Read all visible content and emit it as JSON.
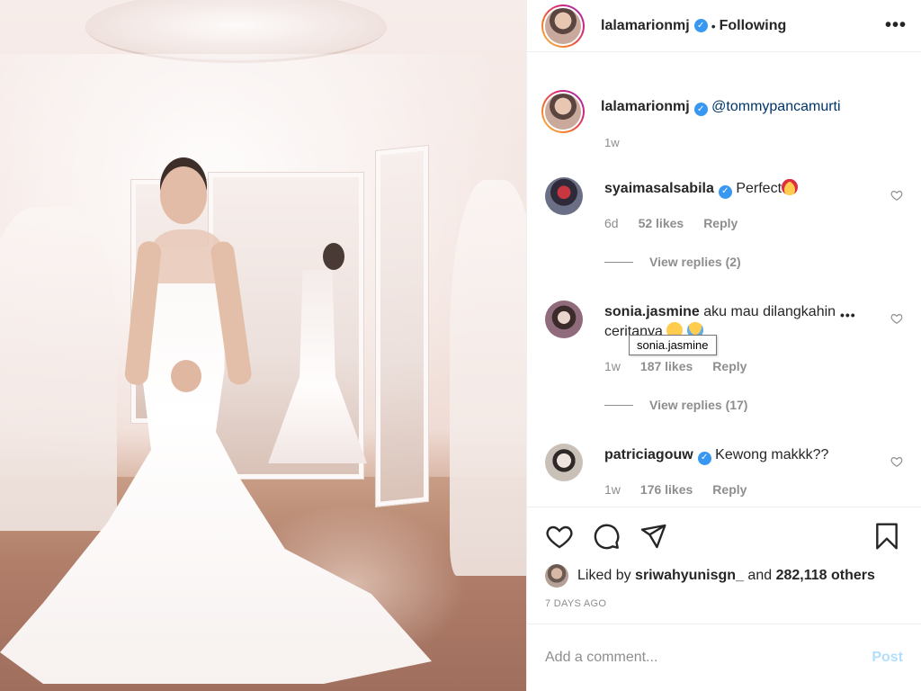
{
  "header": {
    "username": "lalamarionmj",
    "verified_icon": "verified-badge-icon",
    "separator": "•",
    "follow_status": "Following",
    "more_icon": "more-options-icon"
  },
  "caption": {
    "username": "lalamarionmj",
    "mention": "@tommypancamurti",
    "time": "1w"
  },
  "comments": [
    {
      "username": "syaimasalsabila",
      "verified": true,
      "text": "Perfect",
      "emoji": [
        "heart-eyes-emoji"
      ],
      "time": "6d",
      "likes": "52 likes",
      "reply": "Reply",
      "view_replies": "View replies (2)"
    },
    {
      "username": "sonia.jasmine",
      "verified": false,
      "text": "aku mau dilangkahin ceritanya",
      "emoji": [
        "pensive-emoji",
        "crying-emoji"
      ],
      "time": "1w",
      "likes": "187 likes",
      "reply": "Reply",
      "view_replies": "View replies (17)"
    },
    {
      "username": "patriciagouw",
      "verified": true,
      "text": "Kewong makkk??",
      "emoji": [],
      "time": "1w",
      "likes": "176 likes",
      "reply": "Reply"
    }
  ],
  "tooltip": "sonia.jasmine",
  "actions": {
    "like_icon": "heart-icon",
    "comment_icon": "comment-bubble-icon",
    "share_icon": "paper-plane-icon",
    "save_icon": "bookmark-icon",
    "liked_by_prefix": "Liked by",
    "liked_by_user": "sriwahyunisgn_",
    "liked_by_and": "and",
    "liked_by_others": "282,118 others",
    "date": "7 DAYS AGO"
  },
  "add_comment": {
    "placeholder": "Add a comment...",
    "post_label": "Post"
  },
  "colors": {
    "link": "#003569",
    "verified": "#3897f0",
    "post_disabled": "#b2dffc",
    "muted": "#8e8e8e"
  }
}
